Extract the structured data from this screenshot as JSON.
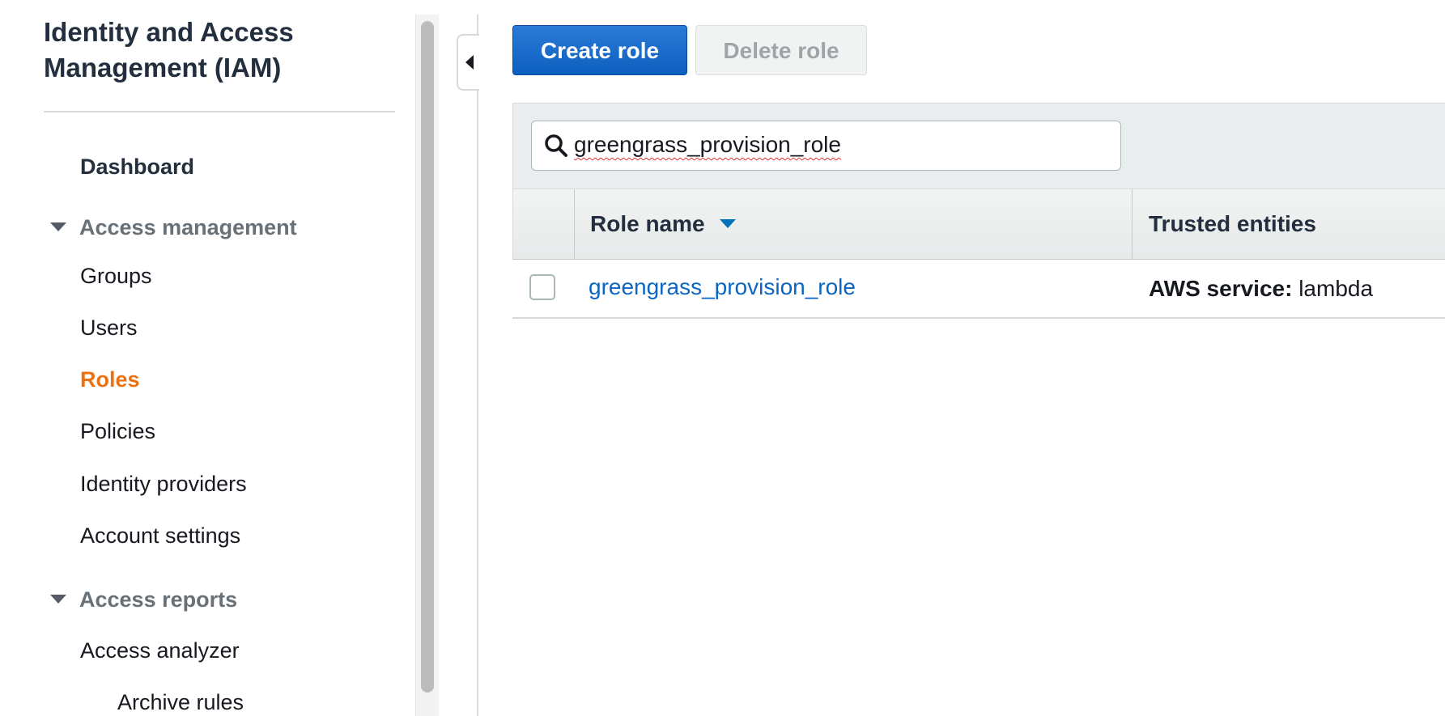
{
  "sidebar": {
    "title": "Identity and Access Management (IAM)",
    "dashboard": "Dashboard",
    "sections": [
      {
        "label": "Access management",
        "items": [
          "Groups",
          "Users",
          "Roles",
          "Policies",
          "Identity providers",
          "Account settings"
        ]
      },
      {
        "label": "Access reports",
        "items": [
          "Access analyzer",
          "Archive rules"
        ]
      }
    ],
    "active_item": "Roles"
  },
  "toolbar": {
    "create_label": "Create role",
    "delete_label": "Delete role"
  },
  "search": {
    "value": "greengrass_provision_role"
  },
  "table": {
    "columns": [
      "Role name",
      "Trusted entities"
    ],
    "rows": [
      {
        "role_name": "greengrass_provision_role",
        "trusted_prefix": "AWS service:",
        "trusted_value": "lambda"
      }
    ]
  },
  "colors": {
    "active": "#ec7211",
    "link": "#0a66c2",
    "primary_button": "#1a6fd0"
  },
  "icons": [
    "search-icon",
    "caret-down-icon",
    "sort-caret-icon",
    "collapse-left-icon"
  ]
}
